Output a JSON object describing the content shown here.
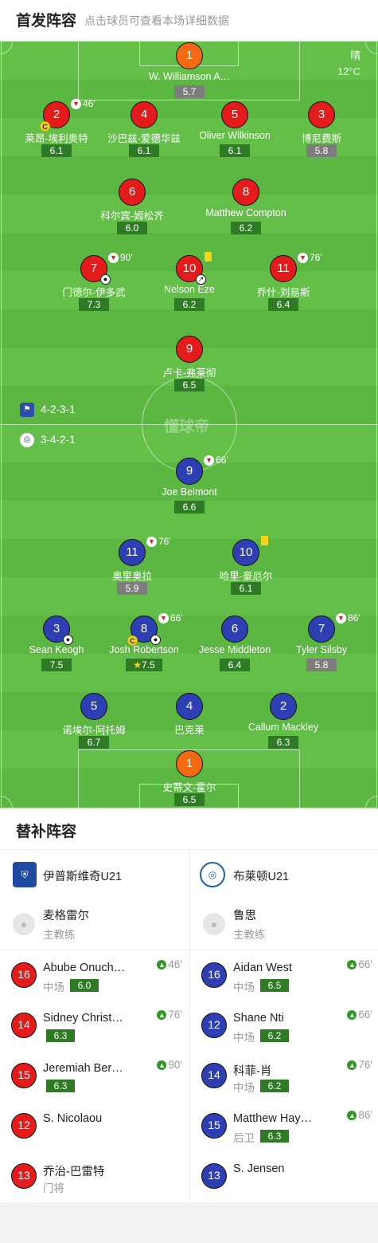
{
  "header": {
    "title": "首发阵容",
    "subtitle": "点击球员可查看本场详细数据"
  },
  "weather": {
    "condition": "晴",
    "temperature": "12°C"
  },
  "watermark": "懂球帝",
  "formations": {
    "home": "4-2-3-1",
    "away": "3-4-2-1"
  },
  "home_players": [
    {
      "number": "1",
      "name": "W. Williamson A…",
      "rating": "5.7",
      "color": "orange"
    },
    {
      "number": "2",
      "name": "莱昂-埃利奥特",
      "rating": "6.1",
      "color": "red",
      "sub_time": "46'",
      "captain": "C"
    },
    {
      "number": "4",
      "name": "沙巴兹-爱德华兹",
      "rating": "6.1",
      "color": "red"
    },
    {
      "number": "5",
      "name": "Oliver Wilkinson",
      "rating": "6.1",
      "color": "red"
    },
    {
      "number": "3",
      "name": "博尼费斯",
      "rating": "5.8",
      "color": "red"
    },
    {
      "number": "6",
      "name": "科尔宾-姆松齐",
      "rating": "6.0",
      "color": "red"
    },
    {
      "number": "8",
      "name": "Matthew Compton",
      "rating": "6.2",
      "color": "red"
    },
    {
      "number": "7",
      "name": "门德尔-伊多武",
      "rating": "7.3",
      "color": "red",
      "sub_time": "90'"
    },
    {
      "number": "10",
      "name": "Nelson Eze",
      "rating": "6.2",
      "color": "red"
    },
    {
      "number": "11",
      "name": "乔什-刘易斯",
      "rating": "6.4",
      "color": "red",
      "sub_time": "76'"
    },
    {
      "number": "9",
      "name": "卢卡-弗莱彻",
      "rating": "6.5",
      "color": "red"
    }
  ],
  "away_players": [
    {
      "number": "9",
      "name": "Joe Belmont",
      "rating": "6.6",
      "color": "blue",
      "sub_time": "66'"
    },
    {
      "number": "11",
      "name": "奥里奥拉",
      "rating": "5.9",
      "color": "blue",
      "sub_time": "76'"
    },
    {
      "number": "10",
      "name": "哈里-豪厄尔",
      "rating": "6.1",
      "color": "blue"
    },
    {
      "number": "3",
      "name": "Sean Keogh",
      "rating": "7.5",
      "color": "blue"
    },
    {
      "number": "8",
      "name": "Josh Robertson",
      "rating": "7.5",
      "color": "blue",
      "sub_time": "66'",
      "captain": "C"
    },
    {
      "number": "6",
      "name": "Jesse Middleton",
      "rating": "6.4",
      "color": "blue"
    },
    {
      "number": "7",
      "name": "Tyler Silsby",
      "rating": "5.8",
      "color": "blue",
      "sub_time": "86'"
    },
    {
      "number": "5",
      "name": "诺埃尔-阿托姆",
      "rating": "6.7",
      "color": "blue"
    },
    {
      "number": "4",
      "name": "巴克莱",
      "rating": "",
      "color": "blue"
    },
    {
      "number": "2",
      "name": "Callum Mackley",
      "rating": "6.3",
      "color": "blue"
    },
    {
      "number": "1",
      "name": "史蒂文-霍尔",
      "rating": "6.5",
      "color": "orange"
    }
  ],
  "subs_section": {
    "title": "替补阵容"
  },
  "home_team": {
    "name": "伊普斯维奇U21",
    "coach": {
      "name": "麦格雷尔",
      "role": "主教练"
    },
    "subs": [
      {
        "number": "16",
        "name": "Abube Onuch…",
        "position": "中场",
        "rating": "6.0",
        "time": "46'"
      },
      {
        "number": "14",
        "name": "Sidney Christ…",
        "position": "",
        "rating": "6.3",
        "time": "76'"
      },
      {
        "number": "15",
        "name": "Jeremiah Ber…",
        "position": "",
        "rating": "6.3",
        "time": "90'"
      },
      {
        "number": "12",
        "name": "S. Nicolaou",
        "position": "",
        "rating": "",
        "time": ""
      },
      {
        "number": "13",
        "name": "乔治-巴雷特",
        "position": "门将",
        "rating": "",
        "time": ""
      }
    ]
  },
  "away_team": {
    "name": "布莱顿U21",
    "coach": {
      "name": "鲁思",
      "role": "主教练"
    },
    "subs": [
      {
        "number": "16",
        "name": "Aidan West",
        "position": "中场",
        "rating": "6.5",
        "time": "66'"
      },
      {
        "number": "12",
        "name": "Shane Nti",
        "position": "中场",
        "rating": "6.2",
        "time": "66'"
      },
      {
        "number": "14",
        "name": "科菲-肖",
        "position": "中场",
        "rating": "6.2",
        "time": "76'"
      },
      {
        "number": "15",
        "name": "Matthew Hay…",
        "position": "后卫",
        "rating": "6.3",
        "time": "86'"
      },
      {
        "number": "13",
        "name": "S. Jensen",
        "position": "",
        "rating": "",
        "time": ""
      }
    ]
  },
  "colors": {
    "home": "#e31b1b",
    "away": "#2d3fb2",
    "keeper": "#f46a12",
    "rating": "#2f7a24",
    "rating_low": "#7d7d7d",
    "pitch": "#5bb741"
  }
}
